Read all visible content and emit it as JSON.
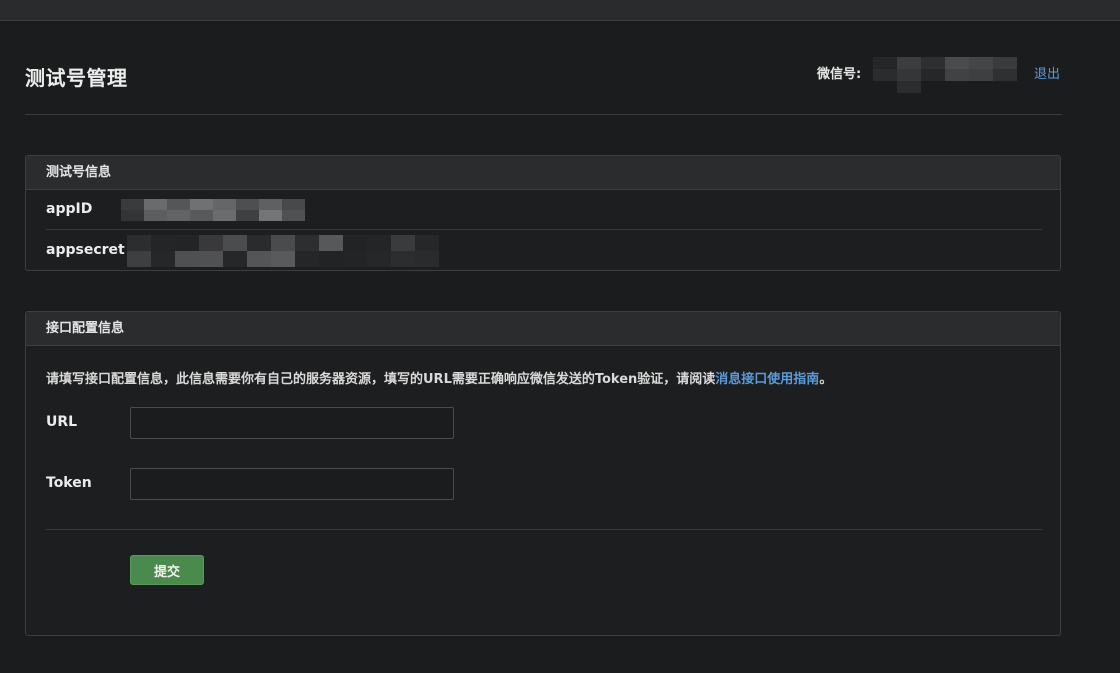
{
  "header": {
    "title": "测试号管理",
    "account_label": "微信号:",
    "logout_label": "退出"
  },
  "test_account_panel": {
    "title": "测试号信息",
    "rows": [
      {
        "label": "appID"
      },
      {
        "label": "appsecret"
      }
    ]
  },
  "config_panel": {
    "title": "接口配置信息",
    "notice_text": "请填写接口配置信息，此信息需要你有自己的服务器资源，填写的URL需要正确响应微信发送的Token验证，请阅读",
    "notice_link": "消息接口使用指南",
    "notice_end": "。",
    "fields": [
      {
        "label": "URL",
        "value": "",
        "placeholder": ""
      },
      {
        "label": "Token",
        "value": "",
        "placeholder": ""
      }
    ],
    "submit_label": "提交"
  },
  "colors": {
    "background": "#1b1c1d",
    "panel_header": "#2b2c2e",
    "link": "#5b9bd8",
    "submit_button": "#4a8a4c"
  }
}
